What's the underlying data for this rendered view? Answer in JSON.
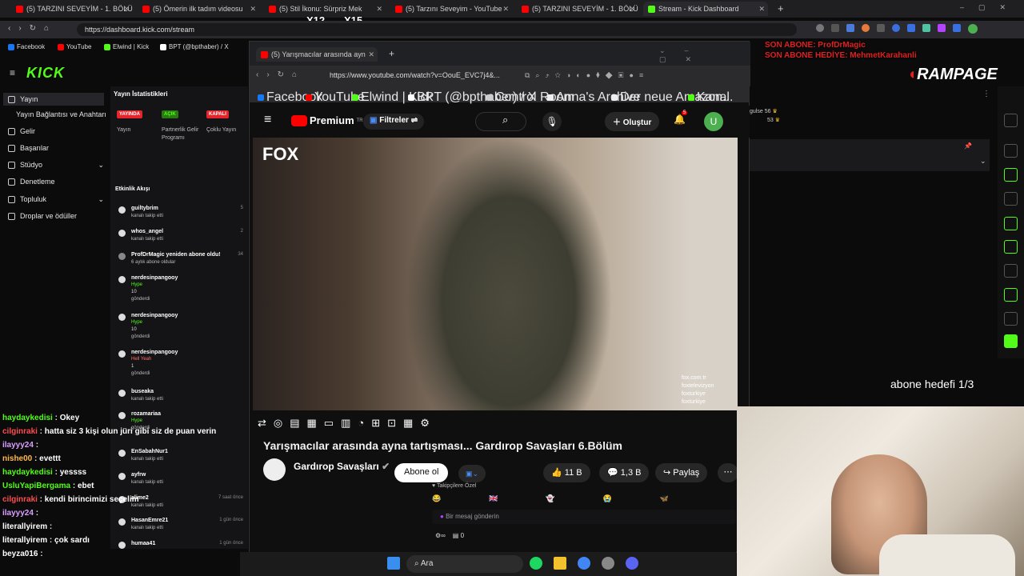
{
  "browser": {
    "tabs": [
      {
        "title": "(5) TARZINI SEVEYİM - 1. BÖLÜM",
        "color": "#ff0000"
      },
      {
        "title": "(5) Ömerin ilk tadım videosu",
        "color": "#ff0000"
      },
      {
        "title": "(5) Stil İkonu: Sürpriz Mek",
        "color": "#ff0000"
      },
      {
        "title": "(5) Tarzını Seveyim - YouTube",
        "color": "#ff0000"
      },
      {
        "title": "(5) TARZINI SEVEYİM - 1. BÖLÜM",
        "color": "#ff0000"
      },
      {
        "title": "Stream - Kick Dashboard",
        "color": "#53fc18"
      }
    ],
    "url": "https://dashboard.kick.com/stream",
    "bookmarks": [
      "Facebook",
      "YouTube",
      "Elwind | Kick",
      "BPT (@bpthaber) / X"
    ]
  },
  "overlay": {
    "gift_x12": "X12",
    "gift_x15": "X15",
    "son_abone": "SON ABONE: ProfDrMagic",
    "son_abone_hediye": "SON ABONE HEDİYE: MehmetKarahanli",
    "rampage": "RAMPAGE",
    "abone_hedefi": "abone hedefi 1/3"
  },
  "kick": {
    "logo": "KICK",
    "sidebar": [
      {
        "label": "Yayın",
        "icon": "broadcast-icon"
      },
      {
        "label": "Yayın Bağlantısı ve Anahtarı",
        "icon": ""
      },
      {
        "label": "Gelir",
        "icon": "revenue-icon"
      },
      {
        "label": "Başarılar",
        "icon": "trophy-icon"
      },
      {
        "label": "Stüdyo",
        "icon": "studio-icon"
      },
      {
        "label": "Denetleme",
        "icon": "moderation-icon"
      },
      {
        "label": "Topluluk",
        "icon": "community-icon"
      },
      {
        "label": "Droplar ve ödüller",
        "icon": "drops-icon"
      }
    ],
    "stats": {
      "title": "Yayın İstatistikleri",
      "items": [
        {
          "badge": "YAYINDA",
          "label": "Yayın",
          "color": "#e5252c"
        },
        {
          "badge": "AÇIK",
          "label": "Partnerlik Gelir Programı",
          "color": "#53fc18"
        },
        {
          "badge": "KAPALI",
          "label": "Çoklu Yayın",
          "color": "#e5252c"
        }
      ]
    },
    "activity": {
      "title": "Etkinlik Akışı",
      "items": [
        {
          "name": "guiltybrim",
          "sub": "kanalı takip etti",
          "time": "5"
        },
        {
          "name": "whos_angel",
          "sub": "kanalı takip etti",
          "time": "2"
        },
        {
          "name": "ProfDrMagic yeniden abone oldu!",
          "sub": "6 aylık abone oldular",
          "time": "34"
        },
        {
          "name": "nerdesinpangooy",
          "hype": "Hype",
          "amount": "10",
          "sub": "gönderdi"
        },
        {
          "name": "nerdesinpangooy",
          "hype": "Hype",
          "amount": "10",
          "sub": "gönderdi"
        },
        {
          "name": "nerdesinpangooy",
          "hype": "Hell Yeah",
          "amount": "1",
          "sub": "gönderdi"
        },
        {
          "name": "buseaka",
          "sub": "kanalı takip etti",
          "time": ""
        },
        {
          "name": "rozamariaa",
          "hype": "Hype",
          "amount": "",
          "sub": "gönderdi"
        },
        {
          "name": "EnSabahNur1",
          "sub": "kanalı takip etti",
          "time": ""
        },
        {
          "name": "ayfrw",
          "sub": "kanalı takip etti",
          "time": ""
        },
        {
          "name": "alime2",
          "sub": "kanalı takip etti",
          "time": "7 saat önce"
        },
        {
          "name": "HasanEmre21",
          "sub": "kanalı takip etti",
          "time": "1 gün önce"
        },
        {
          "name": "humaa41",
          "sub": "",
          "time": "1 gün önce"
        }
      ]
    }
  },
  "chat": [
    {
      "user": "haydaykedisi",
      "msg": "Okey",
      "color": "#53fc18"
    },
    {
      "user": "cilginraki",
      "msg": "hatta siz 3 kişi olun jüri gibi siz de puan verin",
      "color": "#ff4d4d"
    },
    {
      "user": "ilayyy24",
      "msg": "",
      "color": "#d9a0ff"
    },
    {
      "user": "nishe00",
      "msg": "evettt",
      "color": "#ffb84d"
    },
    {
      "user": "haydaykedisi",
      "msg": "yessss",
      "color": "#53fc18"
    },
    {
      "user": "UsluYapiBergama",
      "msg": "ebet",
      "color": "#53fc18"
    },
    {
      "user": "cilginraki",
      "msg": "kendi birincimizi seçelim",
      "color": "#ff4d4d"
    },
    {
      "user": "ilayyy24",
      "msg": "",
      "color": "#d9a0ff"
    },
    {
      "user": "literallyirem",
      "msg": "",
      "color": "#ffffff"
    },
    {
      "user": "literallyirem",
      "msg": "çok sardı",
      "color": "#ffffff"
    },
    {
      "user": "beyza016",
      "msg": "",
      "color": "#ffffff"
    }
  ],
  "youtube": {
    "tab_title": "(5) Yarışmacılar arasında ayn",
    "url": "https://www.youtube.com/watch?v=OouE_EVC7j4&...",
    "bookmarks": [
      "Facebook",
      "YouTube",
      "Elwind | Kick",
      "BPT (@bpthaber) / X",
      "Control Room",
      "Anna's Archive",
      "Der neue Amazon...",
      "Kanal"
    ],
    "logo": "Premium",
    "logo_sup": "TR",
    "filters": "Filtreler",
    "create": "Oluştur",
    "notif_count": "5",
    "avatar": "U",
    "video_brand": "FOX",
    "watermark": [
      "fox.com.tr",
      "foxtelevizyon",
      "foxturkiye",
      "foxturkiye"
    ],
    "title": "Yarışmacılar arasında ayna tartışması... Gardırop Savaşları 6.Bölüm",
    "channel": "Gardırop Savaşları",
    "subscribe": "Abone ol",
    "likes": "11 B",
    "comments": "1,3 B",
    "share": "Paylaş"
  },
  "kick_right": {
    "viewers": [
      {
        "name": "gulse",
        "value": "56"
      },
      {
        "name": "",
        "value": "53"
      }
    ]
  },
  "kick_chat_input": {
    "label": "Takipçilere Özel",
    "placeholder": "Bir mesaj gönderin",
    "count": "0"
  },
  "taskbar": {
    "search": "Ara"
  }
}
